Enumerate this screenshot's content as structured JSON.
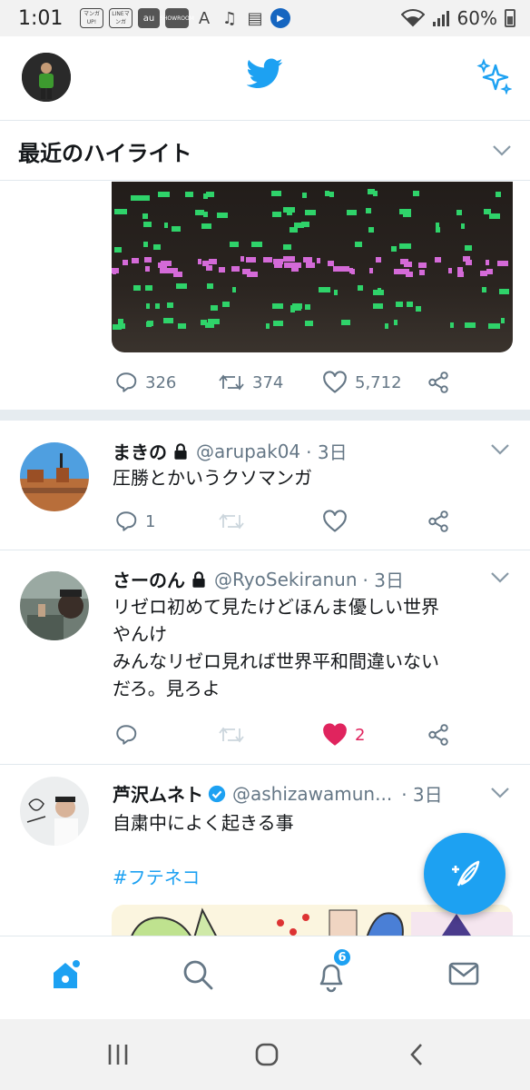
{
  "status_bar": {
    "time": "1:01",
    "apps": [
      "マンガUP!",
      "LINEマンガ",
      "au",
      "SHOWROOM",
      "A",
      "♫",
      "▤",
      "▶"
    ],
    "battery": "60%"
  },
  "header": {
    "avatar_icon": "profile-avatar",
    "logo_icon": "twitter-bird-icon",
    "sparkle_icon": "sparkle-icon"
  },
  "section": {
    "title": "最近のハイライト"
  },
  "highlight_tweet": {
    "replies": "326",
    "retweets": "374",
    "likes": "5,712"
  },
  "tweets": [
    {
      "name": "まきの",
      "handle": "@arupak04",
      "time": "· 3日",
      "lines": [
        "圧勝とかいうクソマンガ"
      ],
      "replies": "1",
      "retweets": "",
      "likes": ""
    },
    {
      "name": "さーのん",
      "handle": "@RyoSekiranun",
      "time": "· 3日",
      "lines": [
        "リゼロ初めて見たけどほんま優しい世界",
        "やんけ",
        "みんなリゼロ見れば世界平和間違いない",
        "だろ。見ろよ"
      ],
      "replies": "",
      "retweets": "",
      "likes": "2"
    },
    {
      "name": "芦沢ムネト",
      "handle": "@ashizawamun...",
      "time": "· 3日",
      "lines": [
        "自粛中によく起きる事"
      ],
      "hashtag": "#フテネコ"
    }
  ],
  "tabbar": {
    "notifications_badge": "6"
  },
  "colors": {
    "accent": "#1da1f2",
    "like_red": "#e0245e",
    "secondary_text": "#657786"
  }
}
